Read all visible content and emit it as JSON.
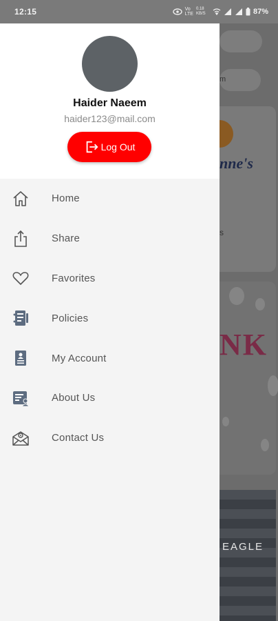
{
  "status_bar": {
    "time": "12:15",
    "indicators": [
      "eye-icon",
      "vo-lte-icon",
      "data-speed-icon",
      "wifi-icon",
      "signal-icon",
      "signal-icon",
      "battery-icon"
    ],
    "data_speed": "0.18 KB/S",
    "battery": "87%"
  },
  "drawer": {
    "user": {
      "name": "Haider Naeem",
      "email": "haider123@mail.com"
    },
    "logout_label": "Log Out",
    "menu": [
      {
        "label": "Home",
        "icon": "home-icon"
      },
      {
        "label": "Share",
        "icon": "share-icon"
      },
      {
        "label": "Favorites",
        "icon": "heart-icon"
      },
      {
        "label": "Policies",
        "icon": "policy-document-icon"
      },
      {
        "label": "My Account",
        "icon": "account-card-icon"
      },
      {
        "label": "About Us",
        "icon": "about-person-icon"
      },
      {
        "label": "Contact Us",
        "icon": "contact-mail-icon"
      }
    ]
  },
  "background": {
    "partial_text": "m",
    "brand1": "nne's",
    "brand1_sub": "s",
    "brand2": "NK",
    "brand3": "EAGLE"
  },
  "colors": {
    "accent": "#ff0000",
    "icon": "#5d6c80",
    "scrim": "#6f6f6f"
  }
}
